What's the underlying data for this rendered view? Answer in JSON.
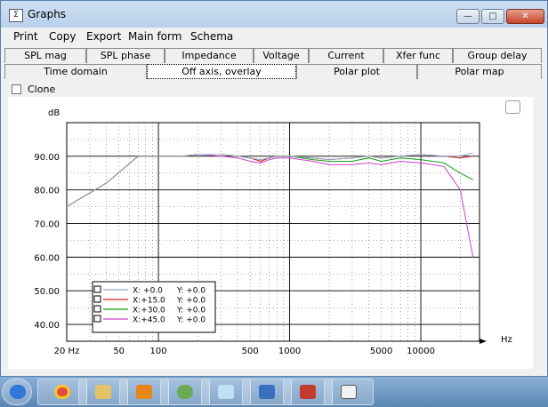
{
  "window": {
    "title": "Graphs"
  },
  "menu": [
    "Print",
    "Copy",
    "Export",
    "Main form",
    "Schema"
  ],
  "tabs_row1": [
    "SPL mag",
    "SPL phase",
    "Impedance",
    "Voltage",
    "Current",
    "Xfer func",
    "Group delay"
  ],
  "tabs_row2": [
    "Time domain",
    "Off axis, overlay",
    "Polar plot",
    "Polar map"
  ],
  "active_tab": "Off axis, overlay",
  "clone": {
    "label": "Clone",
    "checked": false
  },
  "chart_data": {
    "type": "line",
    "ylabel": "dB",
    "xlabel": "Hz",
    "xscale": "log",
    "xlim": [
      20,
      28000
    ],
    "ylim": [
      35,
      100
    ],
    "x_tick_labels": [
      "20 Hz",
      "50",
      "100",
      "500",
      "1000",
      "5000",
      "10000"
    ],
    "y_tick_labels": [
      "40.00",
      "50.00",
      "60.00",
      "70.00",
      "80.00",
      "90.00"
    ],
    "grid": true,
    "legend_position": "bottom-left",
    "series": [
      {
        "name": "X:  +0.0",
        "y_readout": "Y:  +0.0",
        "color": "#8fa8c8",
        "x": [
          20,
          40,
          70,
          100,
          150,
          200,
          300,
          400,
          500,
          600,
          700,
          800,
          1000,
          1500,
          2000,
          3000,
          4000,
          5000,
          7000,
          10000,
          15000,
          20000,
          25000
        ],
        "y": [
          75,
          82,
          90,
          90,
          90,
          90.5,
          90.5,
          90,
          89.5,
          89,
          89.5,
          90,
          90,
          89.5,
          89,
          89.5,
          90,
          89.5,
          90,
          90.5,
          90,
          90,
          91
        ]
      },
      {
        "name": "X:+15.0",
        "y_readout": "Y:  +0.0",
        "color": "#d42020",
        "x": [
          20,
          40,
          70,
          100,
          150,
          200,
          300,
          400,
          500,
          600,
          700,
          800,
          1000,
          1500,
          2000,
          3000,
          4000,
          5000,
          7000,
          10000,
          15000,
          20000,
          25000
        ],
        "y": [
          75,
          82,
          90,
          90,
          90,
          90.5,
          90.5,
          90,
          89.5,
          88.5,
          89.5,
          90,
          90,
          89.5,
          89,
          89.5,
          90,
          89.5,
          90,
          90.5,
          90,
          89.5,
          90
        ]
      },
      {
        "name": "X:+30.0",
        "y_readout": "Y:  +0.0",
        "color": "#12a012",
        "x": [
          20,
          40,
          70,
          100,
          150,
          200,
          300,
          400,
          500,
          600,
          700,
          800,
          1000,
          1500,
          2000,
          3000,
          4000,
          5000,
          7000,
          10000,
          15000,
          20000,
          25000
        ],
        "y": [
          75,
          82,
          90,
          90,
          90,
          90.5,
          90.5,
          90,
          89.5,
          88.5,
          89.5,
          90,
          90,
          89,
          88.5,
          88.5,
          89.5,
          88.5,
          89.5,
          89,
          88,
          85,
          83
        ]
      },
      {
        "name": "X:+45.0",
        "y_readout": "Y:  +0.0",
        "color": "#c840c8",
        "x": [
          20,
          40,
          70,
          100,
          150,
          200,
          300,
          400,
          500,
          600,
          700,
          800,
          1000,
          1500,
          2000,
          3000,
          4000,
          5000,
          7000,
          10000,
          15000,
          20000,
          25000
        ],
        "y": [
          75,
          82,
          90,
          90,
          90,
          90.5,
          90,
          89.5,
          88.5,
          88,
          89,
          89.5,
          89.5,
          88.5,
          87.5,
          87.5,
          88,
          87.5,
          88.5,
          88,
          87,
          80,
          60
        ]
      }
    ]
  },
  "taskbar": [
    "internet-explorer-icon",
    "chrome-icon",
    "explorer-icon",
    "media-player-icon",
    "users-icon",
    "notepad-icon",
    "network-icon",
    "graph-app-icon",
    "graph-window-icon"
  ]
}
